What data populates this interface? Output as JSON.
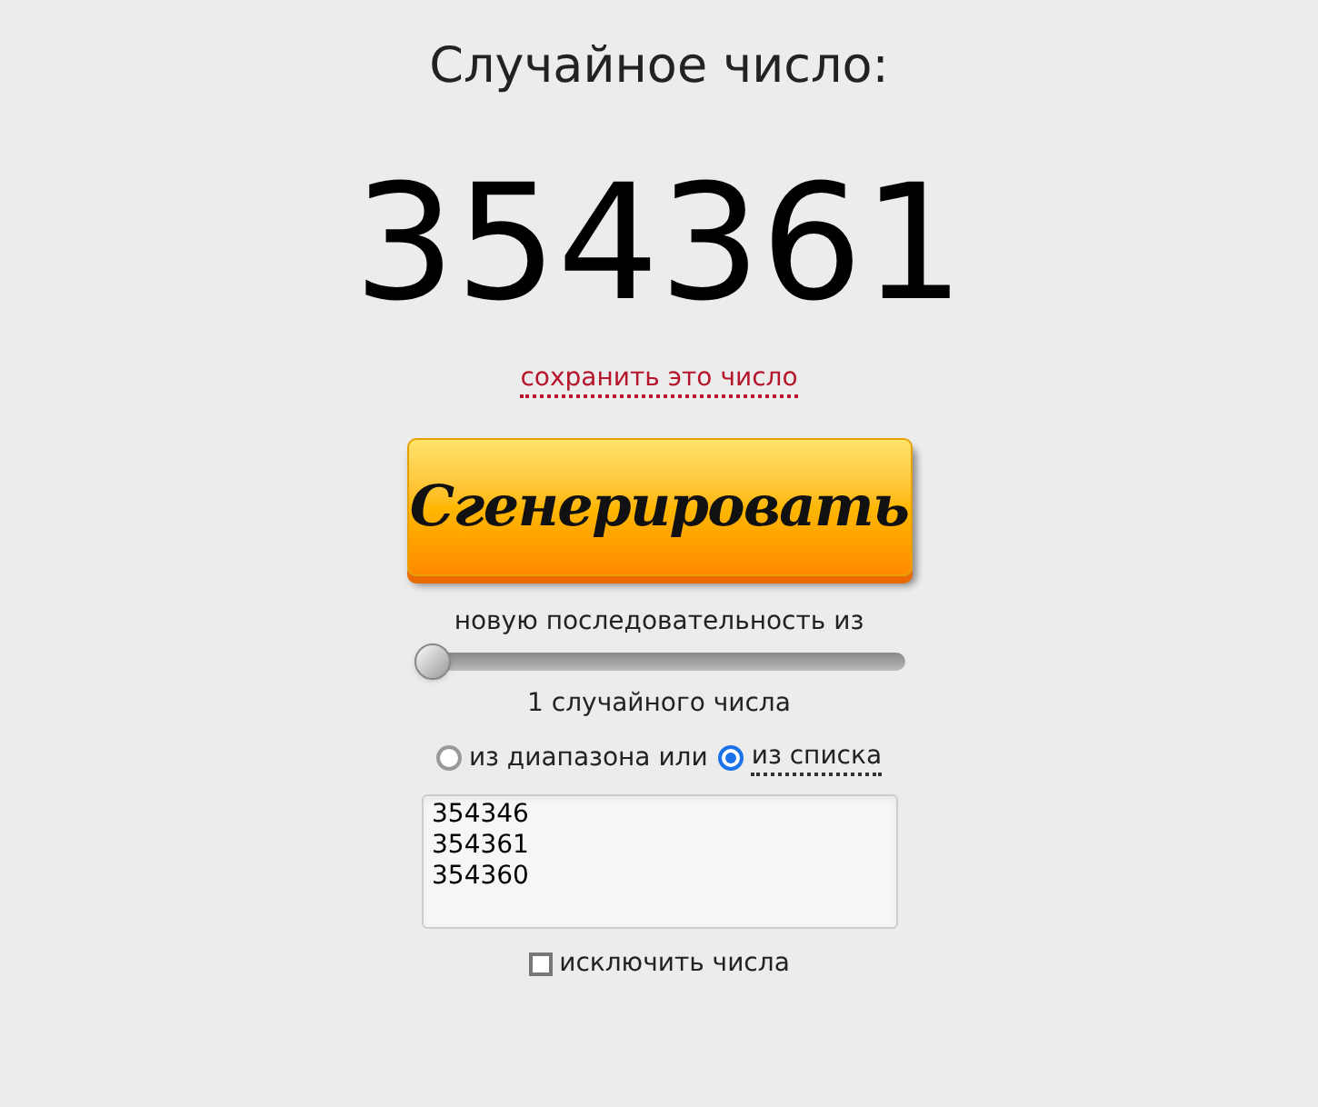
{
  "title": "Случайное число:",
  "number": "354361",
  "save_link": "сохранить это число",
  "generate_button": "Сгенерировать",
  "sequence_label": "новую последовательность из",
  "slider": {
    "level": 0
  },
  "count_label": "1 случайного числа",
  "sources": [
    {
      "label": "из диапазона или",
      "selected": false,
      "kind": "plain"
    },
    {
      "label": "из списка",
      "selected": true,
      "kind": "dotted"
    }
  ],
  "list_field": {
    "lines": [
      "354346",
      "354361",
      "354360"
    ]
  },
  "exclude": {
    "label": "исключить числа",
    "checked": false
  }
}
